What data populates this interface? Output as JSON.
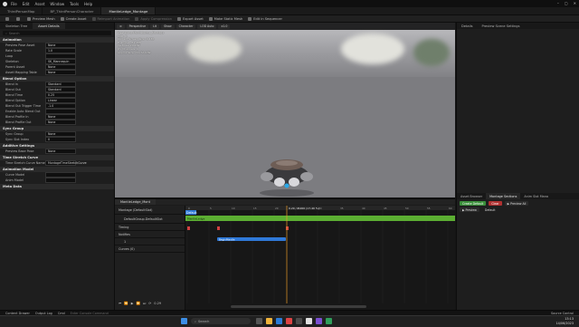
{
  "menu": [
    "File",
    "Edit",
    "Asset",
    "Window",
    "Tools",
    "Help"
  ],
  "tabs": [
    {
      "label": "ThirdPersonMap",
      "active": false
    },
    {
      "label": "BP_ThirdPersonCharacter",
      "active": false
    },
    {
      "label": "MantleLedge_Montage",
      "active": true
    }
  ],
  "toolbar": {
    "preview_mesh": "Preview Mesh",
    "create_asset": "Create Asset",
    "reimport_animation": "Reimport Animation",
    "apply_compression": "Apply Compression",
    "export_asset": "Export Asset",
    "make_static_mesh": "Make Static Mesh",
    "edit_in_sequencer": "Edit in Sequencer"
  },
  "left_panel": {
    "tabs": [
      "Skeleton Tree",
      "Asset Details"
    ],
    "search_placeholder": "Search",
    "sections": [
      {
        "title": "Animation",
        "rows": [
          {
            "label": "Preview Pose Asset",
            "value": "None"
          },
          {
            "label": "Rate Scale",
            "value": "1.0"
          },
          {
            "label": "Loop",
            "value": ""
          },
          {
            "label": "Skeleton",
            "value": "SK_Mannequin"
          },
          {
            "label": "Parent Asset",
            "value": "None"
          },
          {
            "label": "Asset Mapping Table",
            "value": "None"
          }
        ]
      },
      {
        "title": "Blend Option",
        "rows": [
          {
            "label": "Blend In",
            "value": "Standard"
          },
          {
            "label": "Blend Out",
            "value": "Standard"
          },
          {
            "label": "Blend Time",
            "value": "0.25"
          },
          {
            "label": "Blend Option",
            "value": "Linear"
          },
          {
            "label": "Blend Out Trigger Time",
            "value": "-1.0"
          },
          {
            "label": "Enable Auto Blend Out",
            "value": ""
          },
          {
            "label": "Blend Profile In",
            "value": "None"
          },
          {
            "label": "Blend Profile Out",
            "value": "None"
          }
        ]
      },
      {
        "title": "Sync Group",
        "rows": [
          {
            "label": "Sync Group",
            "value": "None"
          },
          {
            "label": "Sync Slot Index",
            "value": "0"
          }
        ]
      },
      {
        "title": "Additive Settings",
        "rows": [
          {
            "label": "Preview Base Pose",
            "value": "None"
          }
        ]
      },
      {
        "title": "Time Stretch Curve",
        "rows": [
          {
            "label": "Time Stretch Curve Name",
            "value": "MontageTimeStretchCurve"
          }
        ]
      },
      {
        "title": "Animation Model",
        "rows": [
          {
            "label": "Curve Model",
            "value": ""
          },
          {
            "label": "Anim Model",
            "value": ""
          }
        ]
      },
      {
        "title": "Meta Data",
        "rows": []
      }
    ]
  },
  "viewport": {
    "buttons": [
      "Perspective",
      "Lit",
      "Show",
      "Character",
      "LOD Auto",
      "x1.0"
    ],
    "info_lines": [
      "Previewing MantleLedge_Montage",
      "LOD: 0",
      "Current Screen Size: 0.436",
      "Triangles: 34,488",
      "Vertices: 20,184",
      "UV Channels: 1",
      "Approx Size: 71x72x182"
    ]
  },
  "right_panel": {
    "tabs": [
      "Details",
      "Preview Scene Settings"
    ]
  },
  "sequencer": {
    "tab": "MantleLedge_Mont",
    "tracks": [
      "Montage (DefaultSlot)",
      "DefaultGroup.DefaultSlot",
      "Timing",
      "Notifies",
      "1",
      "Curves (0)"
    ],
    "playhead_label": "0.29 / 1.000 (17.40 %)",
    "section_name": "Default",
    "segment_label": "MantleLedge",
    "notify_label": "BeginMantle",
    "ticks": [
      "0",
      "5",
      "10",
      "15",
      "20",
      "25",
      "30",
      "35",
      "40",
      "45",
      "50",
      "55",
      "60"
    ],
    "transport_time": "0.29"
  },
  "asset_browser": {
    "tabs": [
      "Asset Browser",
      "Montage Sections",
      "Anim Slot Mana"
    ],
    "create_default": "Create Default",
    "clear": "Clear",
    "preview_all": "Preview All",
    "preview": "Preview",
    "default_label": "Default"
  },
  "statusbar": {
    "content_drawer": "Content Drawer",
    "output_log": "Output Log",
    "cmd": "Cmd",
    "console_placeholder": "Enter Console Command",
    "source_control": "Source Control"
  },
  "taskbar": {
    "search_placeholder": "Search",
    "time": "13:13",
    "date": "14/06/2023"
  },
  "colors": {
    "accent_orange": "#e79b28",
    "green_bar": "#5cae32",
    "segment_blue": "#2f79d8",
    "create_default_green": "#3a8f3a",
    "clear_red": "#b03030"
  }
}
